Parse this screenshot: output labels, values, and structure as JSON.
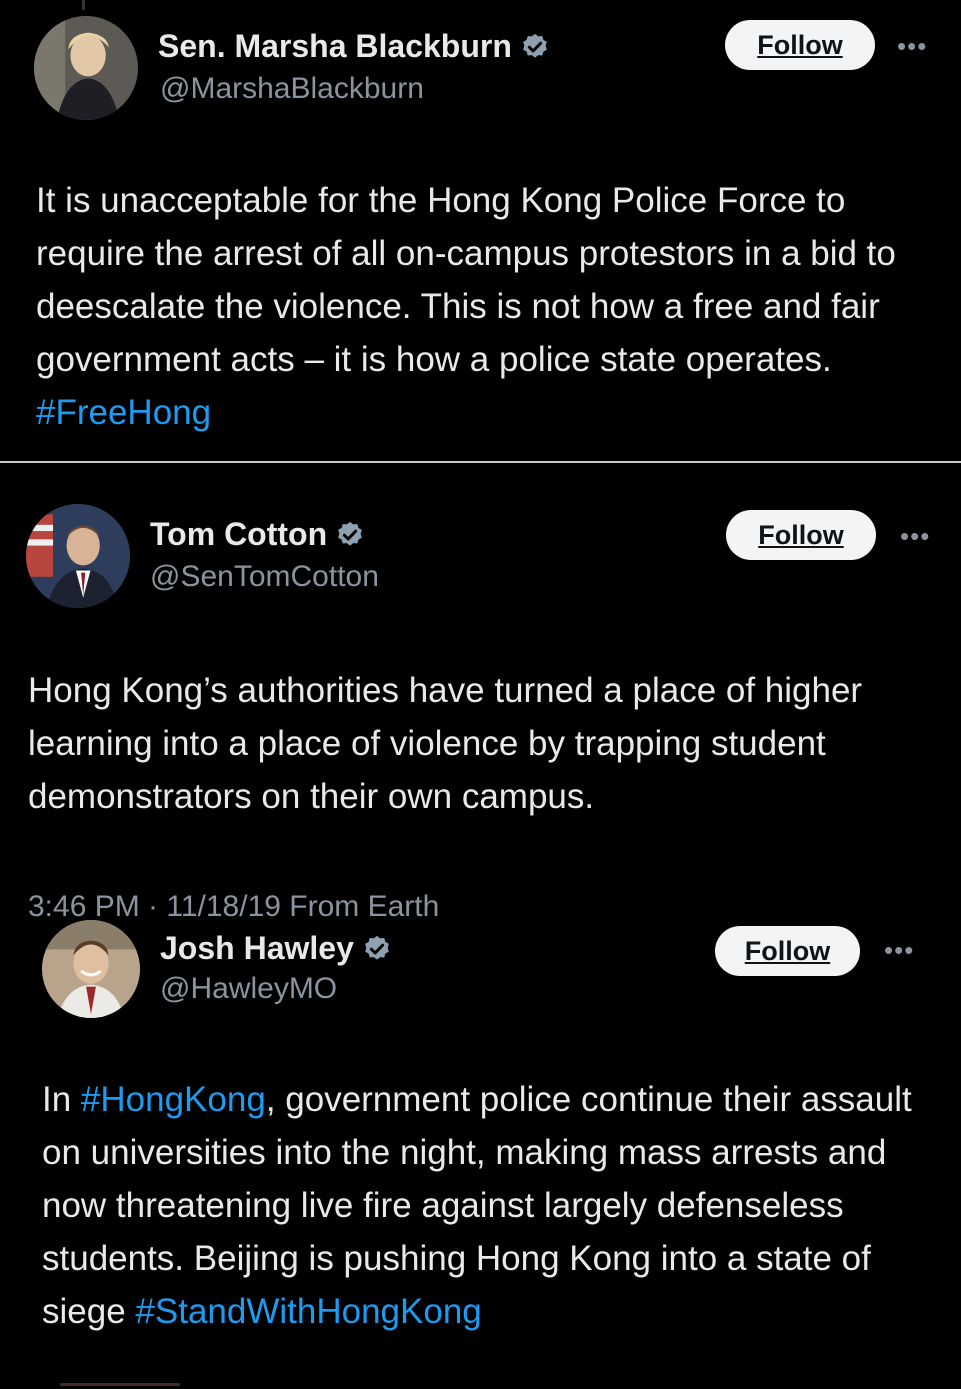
{
  "tweets": [
    {
      "name": "Sen. Marsha Blackburn",
      "handle": "@MarshaBlackburn",
      "follow_label": "Follow",
      "more_label": "•••",
      "text_before": "It is unacceptable for the Hong Kong Police Force to require the arrest of all on-campus protestors in a bid to deescalate the violence. This is not how a free and fair government acts – it is how a police state operates. ",
      "hashtag": "#FreeHong"
    },
    {
      "name": "Tom Cotton",
      "handle": "@SenTomCotton",
      "follow_label": "Follow",
      "more_label": "•••",
      "text": "Hong Kong’s authorities have turned a place of higher learning into a place of violence by trapping student demonstrators on their own campus.",
      "timestamp": "3:46 PM · 11/18/19 From Earth"
    },
    {
      "name": "Josh Hawley",
      "handle": "@HawleyMO",
      "follow_label": "Follow",
      "more_label": "•••",
      "text_prefix": "In ",
      "hashtag1": "#HongKong",
      "text_middle": ", government police continue their assault on universities into the night, making mass arrests and now threatening live fire against largely defenseless students. Beijing is pushing Hong Kong into a state of siege ",
      "hashtag2": "#StandWithHongKong"
    }
  ],
  "colors": {
    "background": "#000000",
    "text": "#e7e9ea",
    "secondary": "#8b949e",
    "hashtag": "#1d9bf0",
    "verified": "#8fa0b0",
    "follow_bg": "#f3f4f5"
  },
  "icons": {
    "verified": "verified-badge-icon",
    "more": "more-options-icon"
  }
}
